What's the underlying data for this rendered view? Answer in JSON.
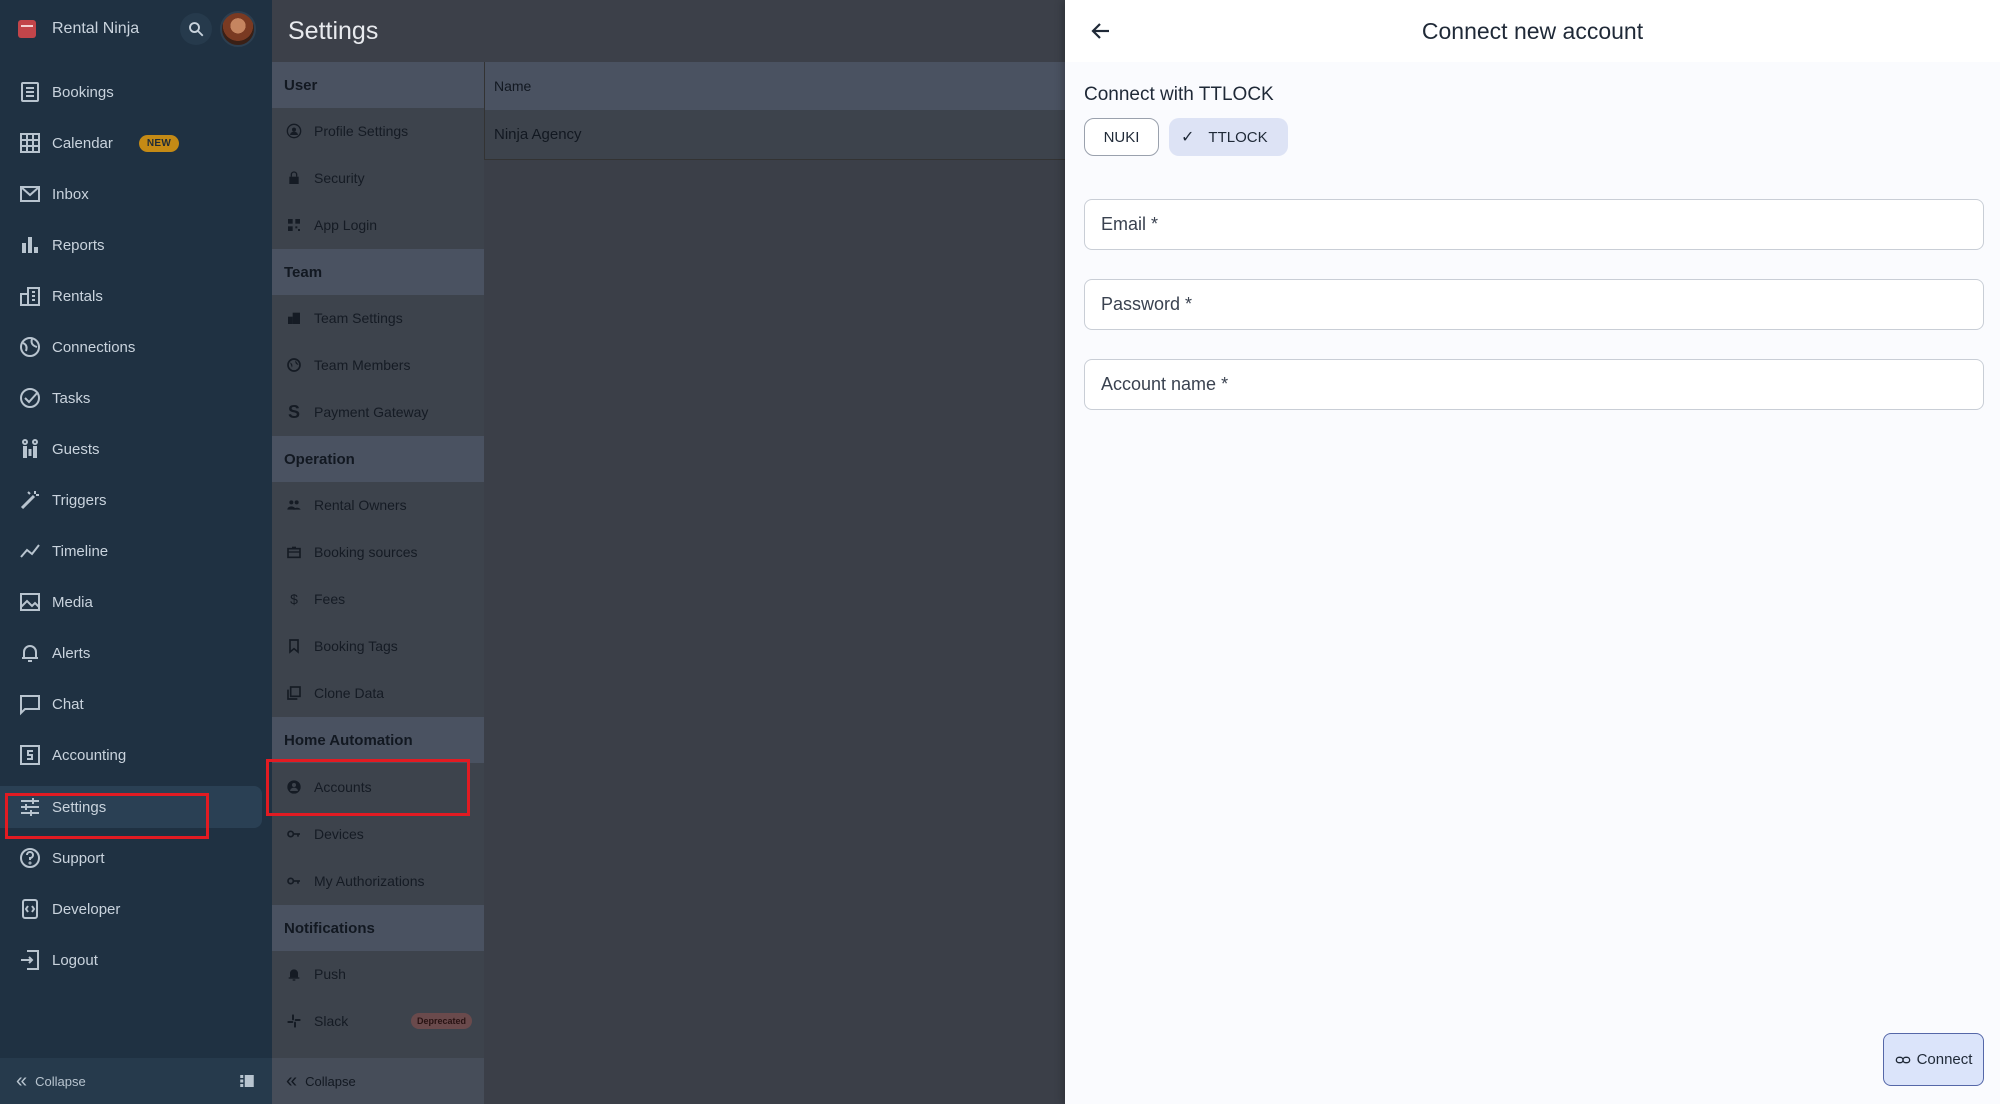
{
  "app": {
    "name": "Rental Ninja"
  },
  "nav": {
    "items": [
      {
        "label": "Bookings",
        "icon": "bookings-icon"
      },
      {
        "label": "Calendar",
        "icon": "calendar-icon",
        "badge": "NEW"
      },
      {
        "label": "Inbox",
        "icon": "inbox-icon"
      },
      {
        "label": "Reports",
        "icon": "reports-icon"
      },
      {
        "label": "Rentals",
        "icon": "rentals-icon"
      },
      {
        "label": "Connections",
        "icon": "connections-icon"
      },
      {
        "label": "Tasks",
        "icon": "tasks-icon"
      },
      {
        "label": "Guests",
        "icon": "guests-icon"
      },
      {
        "label": "Triggers",
        "icon": "triggers-icon"
      },
      {
        "label": "Timeline",
        "icon": "timeline-icon"
      },
      {
        "label": "Media",
        "icon": "media-icon"
      },
      {
        "label": "Alerts",
        "icon": "alerts-icon"
      },
      {
        "label": "Chat",
        "icon": "chat-icon"
      },
      {
        "label": "Accounting",
        "icon": "accounting-icon"
      },
      {
        "label": "Settings",
        "icon": "settings-icon"
      },
      {
        "label": "Support",
        "icon": "support-icon"
      },
      {
        "label": "Developer",
        "icon": "developer-icon"
      },
      {
        "label": "Logout",
        "icon": "logout-icon"
      }
    ],
    "collapse_label": "Collapse"
  },
  "settings": {
    "title": "Settings",
    "sections": [
      {
        "title": "User",
        "items": [
          {
            "label": "Profile Settings",
            "icon": "profile-icon"
          },
          {
            "label": "Security",
            "icon": "lock-icon"
          },
          {
            "label": "App Login",
            "icon": "qr-icon"
          }
        ]
      },
      {
        "title": "Team",
        "items": [
          {
            "label": "Team Settings",
            "icon": "building-icon"
          },
          {
            "label": "Team Members",
            "icon": "globe-icon"
          },
          {
            "label": "Payment Gateway",
            "icon": "stripe-icon"
          }
        ]
      },
      {
        "title": "Operation",
        "items": [
          {
            "label": "Rental Owners",
            "icon": "people-icon"
          },
          {
            "label": "Booking sources",
            "icon": "briefcase-icon"
          },
          {
            "label": "Fees",
            "icon": "dollar-icon"
          },
          {
            "label": "Booking Tags",
            "icon": "bookmark-icon"
          },
          {
            "label": "Clone Data",
            "icon": "clone-icon"
          }
        ]
      },
      {
        "title": "Home Automation",
        "items": [
          {
            "label": "Accounts",
            "icon": "account-circle-icon"
          },
          {
            "label": "Devices",
            "icon": "key-icon"
          },
          {
            "label": "My Authorizations",
            "icon": "key-icon"
          }
        ]
      },
      {
        "title": "Notifications",
        "items": [
          {
            "label": "Push",
            "icon": "bell-icon"
          },
          {
            "label": "Slack",
            "icon": "slack-icon",
            "badge": "Deprecated"
          }
        ]
      }
    ],
    "collapse_label": "Collapse"
  },
  "table": {
    "header": "Name",
    "rows": [
      "Ninja Agency"
    ]
  },
  "panel": {
    "title": "Connect new account",
    "connect_with": "Connect with TTLOCK",
    "providers": [
      {
        "label": "NUKI",
        "selected": false
      },
      {
        "label": "TTLOCK",
        "selected": true
      }
    ],
    "fields": {
      "email_placeholder": "Email *",
      "password_placeholder": "Password *",
      "account_name_placeholder": "Account name *"
    },
    "connect_label": "Connect"
  },
  "colors": {
    "sidebar_bg": "#1f3142",
    "highlight": "#e21b22",
    "chip_selected": "#dde3f5",
    "badge_new": "#c48a15"
  }
}
